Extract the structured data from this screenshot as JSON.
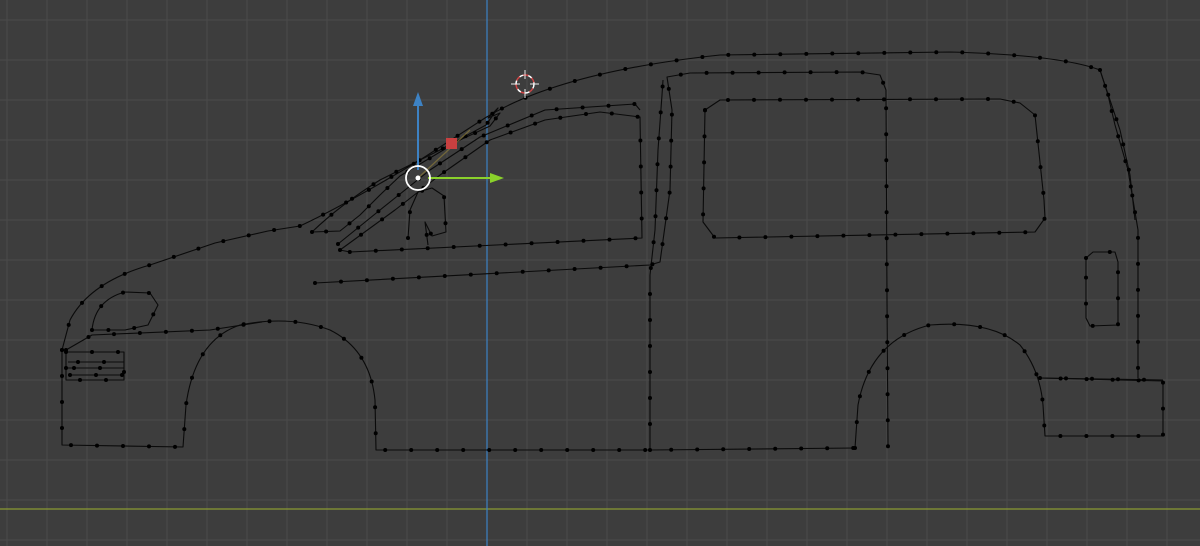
{
  "viewport": {
    "background_color": "#3d3d3d",
    "grid_color": "#4a4a4a",
    "x_axis_color": "#8a9a32",
    "z_axis_color": "#3d82c4"
  },
  "object": {
    "type": "curve outline",
    "wire_color": "#0a0a0a",
    "vertex_color": "#000000"
  },
  "cursor_3d": {
    "icon": "crosshair-icon",
    "ring_colors": [
      "#ffffff",
      "#d04545"
    ]
  },
  "gizmo": {
    "icon": "translate-gizmo-icon",
    "z_arrow_color": "#3d82c4",
    "x_arrow_color": "#8ad12b",
    "plane_handle_color": "#c84040",
    "center_color": "#ffffff"
  }
}
